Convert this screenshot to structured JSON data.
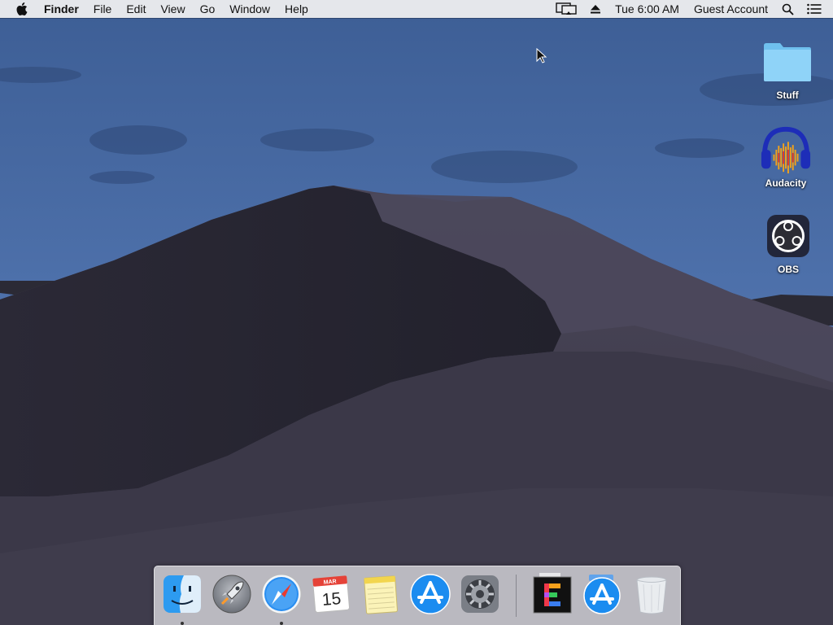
{
  "menubar": {
    "app_name": "Finder",
    "menus": [
      "File",
      "Edit",
      "View",
      "Go",
      "Window",
      "Help"
    ],
    "clock": "Tue 6:00 AM",
    "user": "Guest Account",
    "icons": [
      "apple-logo-icon",
      "display-mirroring-icon",
      "eject-icon",
      "spotlight-icon",
      "notification-center-icon"
    ]
  },
  "desktop": {
    "icons": [
      {
        "label": "Stuff",
        "icon": "folder-icon"
      },
      {
        "label": "Audacity",
        "icon": "audacity-icon"
      },
      {
        "label": "OBS",
        "icon": "obs-icon"
      }
    ]
  },
  "dock": {
    "apps": [
      {
        "icon": "finder-icon",
        "running": true
      },
      {
        "icon": "launchpad-icon",
        "running": false
      },
      {
        "icon": "safari-icon",
        "running": true
      },
      {
        "icon": "calendar-icon",
        "running": false,
        "month": "MAR",
        "day": "15"
      },
      {
        "icon": "notes-icon",
        "running": false
      },
      {
        "icon": "app-store-icon",
        "running": false
      },
      {
        "icon": "system-preferences-icon",
        "running": false
      }
    ],
    "secondary": [
      {
        "icon": "e-app-icon",
        "letter": "E"
      },
      {
        "icon": "app-store-downloads-icon"
      },
      {
        "icon": "trash-icon"
      }
    ]
  },
  "colors": {
    "sky_top": "#3e5f96",
    "sky_bottom": "#5a7eb6",
    "dune_dark": "#2e2c3c",
    "dune_light": "#48455a",
    "folder_blue": "#7ecbf5",
    "menubar_bg": "#ececee"
  }
}
